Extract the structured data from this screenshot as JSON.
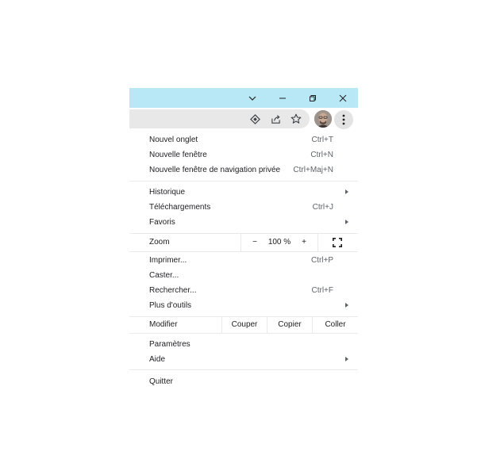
{
  "window": {
    "titlebar_color": "#b8e8f5",
    "controls": [
      "tab-search",
      "minimize",
      "restore",
      "close"
    ]
  },
  "toolbar": {
    "icons": [
      "lens-icon",
      "share-icon",
      "bookmark-star-icon"
    ],
    "avatar": "profile-avatar",
    "menu_icon": "three-dots-vertical-icon"
  },
  "menu": {
    "new_tab": {
      "label": "Nouvel onglet",
      "shortcut": "Ctrl+T"
    },
    "new_window": {
      "label": "Nouvelle fenêtre",
      "shortcut": "Ctrl+N"
    },
    "incognito": {
      "label": "Nouvelle fenêtre de navigation privée",
      "shortcut": "Ctrl+Maj+N"
    },
    "history": {
      "label": "Historique"
    },
    "downloads": {
      "label": "Téléchargements",
      "shortcut": "Ctrl+J"
    },
    "favorites": {
      "label": "Favoris"
    },
    "zoom": {
      "label": "Zoom",
      "minus": "−",
      "value": "100 %",
      "plus": "+"
    },
    "print": {
      "label": "Imprimer...",
      "shortcut": "Ctrl+P"
    },
    "cast": {
      "label": "Caster..."
    },
    "find": {
      "label": "Rechercher...",
      "shortcut": "Ctrl+F"
    },
    "more_tools": {
      "label": "Plus d'outils"
    },
    "edit": {
      "label": "Modifier",
      "cut": "Couper",
      "copy": "Copier",
      "paste": "Coller"
    },
    "settings": {
      "label": "Paramètres"
    },
    "help": {
      "label": "Aide"
    },
    "quit": {
      "label": "Quitter"
    }
  }
}
